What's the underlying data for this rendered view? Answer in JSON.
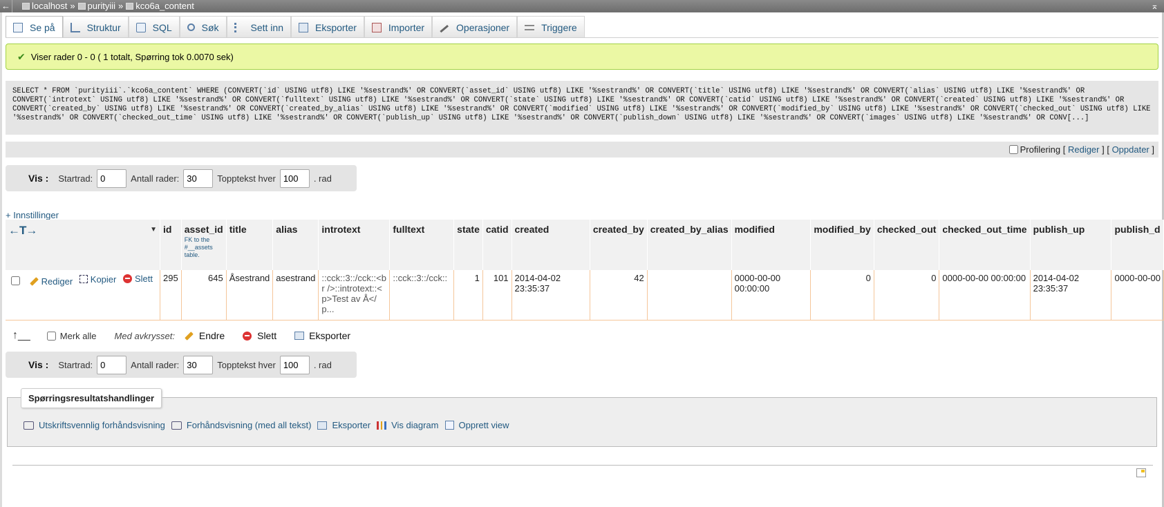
{
  "breadcrumb": {
    "server": "localhost",
    "database": "purityiii",
    "table": "kco6a_content",
    "separator": "»"
  },
  "tabs": [
    {
      "label": "Se på",
      "icon": "browse-icon",
      "active": true
    },
    {
      "label": "Struktur",
      "icon": "structure-icon"
    },
    {
      "label": "SQL",
      "icon": "sql-icon"
    },
    {
      "label": "Søk",
      "icon": "search-icon"
    },
    {
      "label": "Sett inn",
      "icon": "insert-icon"
    },
    {
      "label": "Eksporter",
      "icon": "export-icon"
    },
    {
      "label": "Importer",
      "icon": "import-icon"
    },
    {
      "label": "Operasjoner",
      "icon": "wrench-icon"
    },
    {
      "label": "Triggere",
      "icon": "trigger-icon"
    }
  ],
  "message": {
    "text": "Viser rader 0 - 0 ( 1 totalt, Spørring tok 0.0070 sek)",
    "color": "#ebf8a4"
  },
  "sql": {
    "query": "SELECT * FROM `purityiii`.`kco6a_content` WHERE (CONVERT(`id` USING utf8) LIKE '%sestrand%' OR CONVERT(`asset_id` USING utf8) LIKE '%sestrand%' OR CONVERT(`title` USING utf8) LIKE '%sestrand%' OR CONVERT(`alias` USING utf8) LIKE '%sestrand%' OR CONVERT(`introtext` USING utf8) LIKE '%sestrand%' OR CONVERT(`fulltext` USING utf8) LIKE '%sestrand%' OR CONVERT(`state` USING utf8) LIKE '%sestrand%' OR CONVERT(`catid` USING utf8) LIKE '%sestrand%' OR CONVERT(`created` USING utf8) LIKE '%sestrand%' OR CONVERT(`created_by` USING utf8) LIKE '%sestrand%' OR CONVERT(`created_by_alias` USING utf8) LIKE '%sestrand%' OR CONVERT(`modified` USING utf8) LIKE '%sestrand%' OR CONVERT(`modified_by` USING utf8) LIKE '%sestrand%' OR CONVERT(`checked_out` USING utf8) LIKE '%sestrand%' OR CONVERT(`checked_out_time` USING utf8) LIKE '%sestrand%' OR CONVERT(`publish_up` USING utf8) LIKE '%sestrand%' OR CONVERT(`publish_down` USING utf8) LIKE '%sestrand%' OR CONVERT(`images` USING utf8) LIKE '%sestrand%' OR CONV[...]",
    "profiling_label": "Profilering",
    "edit_label": "Rediger",
    "refresh_label": "Oppdater"
  },
  "nav": {
    "show_label": "Vis :",
    "start_label": "Startrad:",
    "start_value": "0",
    "rows_label": "Antall rader:",
    "rows_value": "30",
    "header_label": "Topptekst hver",
    "header_value": "100",
    "row_suffix": ". rad"
  },
  "settings_link": "+ Innstillinger",
  "table": {
    "arrows": "←T→",
    "columns": [
      {
        "name": "id"
      },
      {
        "name": "asset_id",
        "sub": "FK to the #__assets table."
      },
      {
        "name": "title"
      },
      {
        "name": "alias"
      },
      {
        "name": "introtext"
      },
      {
        "name": "fulltext"
      },
      {
        "name": "state"
      },
      {
        "name": "catid"
      },
      {
        "name": "created"
      },
      {
        "name": "created_by"
      },
      {
        "name": "created_by_alias"
      },
      {
        "name": "modified"
      },
      {
        "name": "modified_by"
      },
      {
        "name": "checked_out"
      },
      {
        "name": "checked_out_time"
      },
      {
        "name": "publish_up"
      },
      {
        "name": "publish_d"
      }
    ],
    "row_actions": {
      "edit": "Rediger",
      "copy": "Kopier",
      "delete": "Slett"
    },
    "rows": [
      {
        "id": "295",
        "asset_id": "645",
        "title": "Åsestrand",
        "alias": "asestrand",
        "introtext": "::cck::3::/cck::<br />::introtext::<p>Test av Å</p...",
        "fulltext": "::cck::3::/cck::",
        "state": "1",
        "catid": "101",
        "created": "2014-04-02 23:35:37",
        "created_by": "42",
        "created_by_alias": "",
        "modified": "0000-00-00 00:00:00",
        "modified_by": "0",
        "checked_out": "0",
        "checked_out_time": "0000-00-00 00:00:00",
        "publish_up": "2014-04-02 23:35:37",
        "publish_down": "0000-00-00"
      }
    ]
  },
  "bulk": {
    "select_all": "Merk alle",
    "with_selected": "Med avkrysset:",
    "edit": "Endre",
    "delete": "Slett",
    "export": "Eksporter"
  },
  "query_ops": {
    "legend": "Spørringsresultatshandlinger",
    "print": "Utskriftsvennlig forhåndsvisning",
    "print_full": "Forhåndsvisning (med all tekst)",
    "export": "Eksporter",
    "chart": "Vis diagram",
    "create_view": "Opprett view"
  }
}
